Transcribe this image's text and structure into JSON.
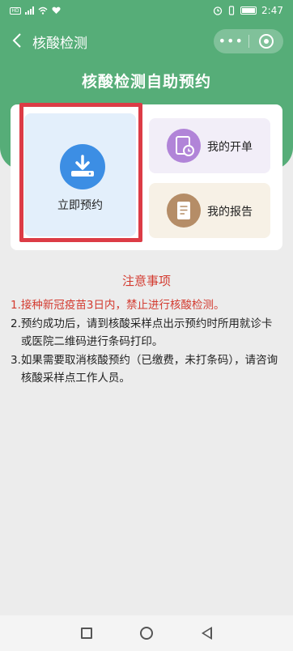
{
  "status_bar": {
    "time": "2:47",
    "icons": [
      "hd-icon",
      "signal-icon",
      "wifi-icon",
      "heart-icon",
      "alarm-icon",
      "vibrate-icon",
      "battery-icon"
    ]
  },
  "nav": {
    "title": "核酸检测",
    "more_label": "•••",
    "icons": [
      "back-arrow-icon",
      "more-dots-icon",
      "target-close-icon"
    ]
  },
  "page": {
    "title": "核酸检测自助预约"
  },
  "menu": {
    "main": {
      "label": "立即预约",
      "icon": "download-icon",
      "highlighted": true
    },
    "orders": {
      "label": "我的开单",
      "icon": "clock-document-icon"
    },
    "reports": {
      "label": "我的报告",
      "icon": "report-document-icon"
    }
  },
  "notice": {
    "title": "注意事项",
    "items": [
      {
        "num": "1.",
        "text": "接种新冠疫苗3日内，禁止进行核酸检测。"
      },
      {
        "num": "2.",
        "text": "预约成功后，请到核酸采样点出示预约时所用就诊卡或医院二维码进行条码打印。"
      },
      {
        "num": "3.",
        "text": "如果需要取消核酸预约（已缴费，未打条码），请咨询核酸采样点工作人员。"
      }
    ]
  },
  "colors": {
    "brand_green": "#56ad78",
    "notice_red": "#d33a2f",
    "highlight_red": "#dc3c46",
    "download_blue": "#3c8ee4",
    "orders_purple": "#b184d8",
    "reports_brown": "#b58d67"
  }
}
